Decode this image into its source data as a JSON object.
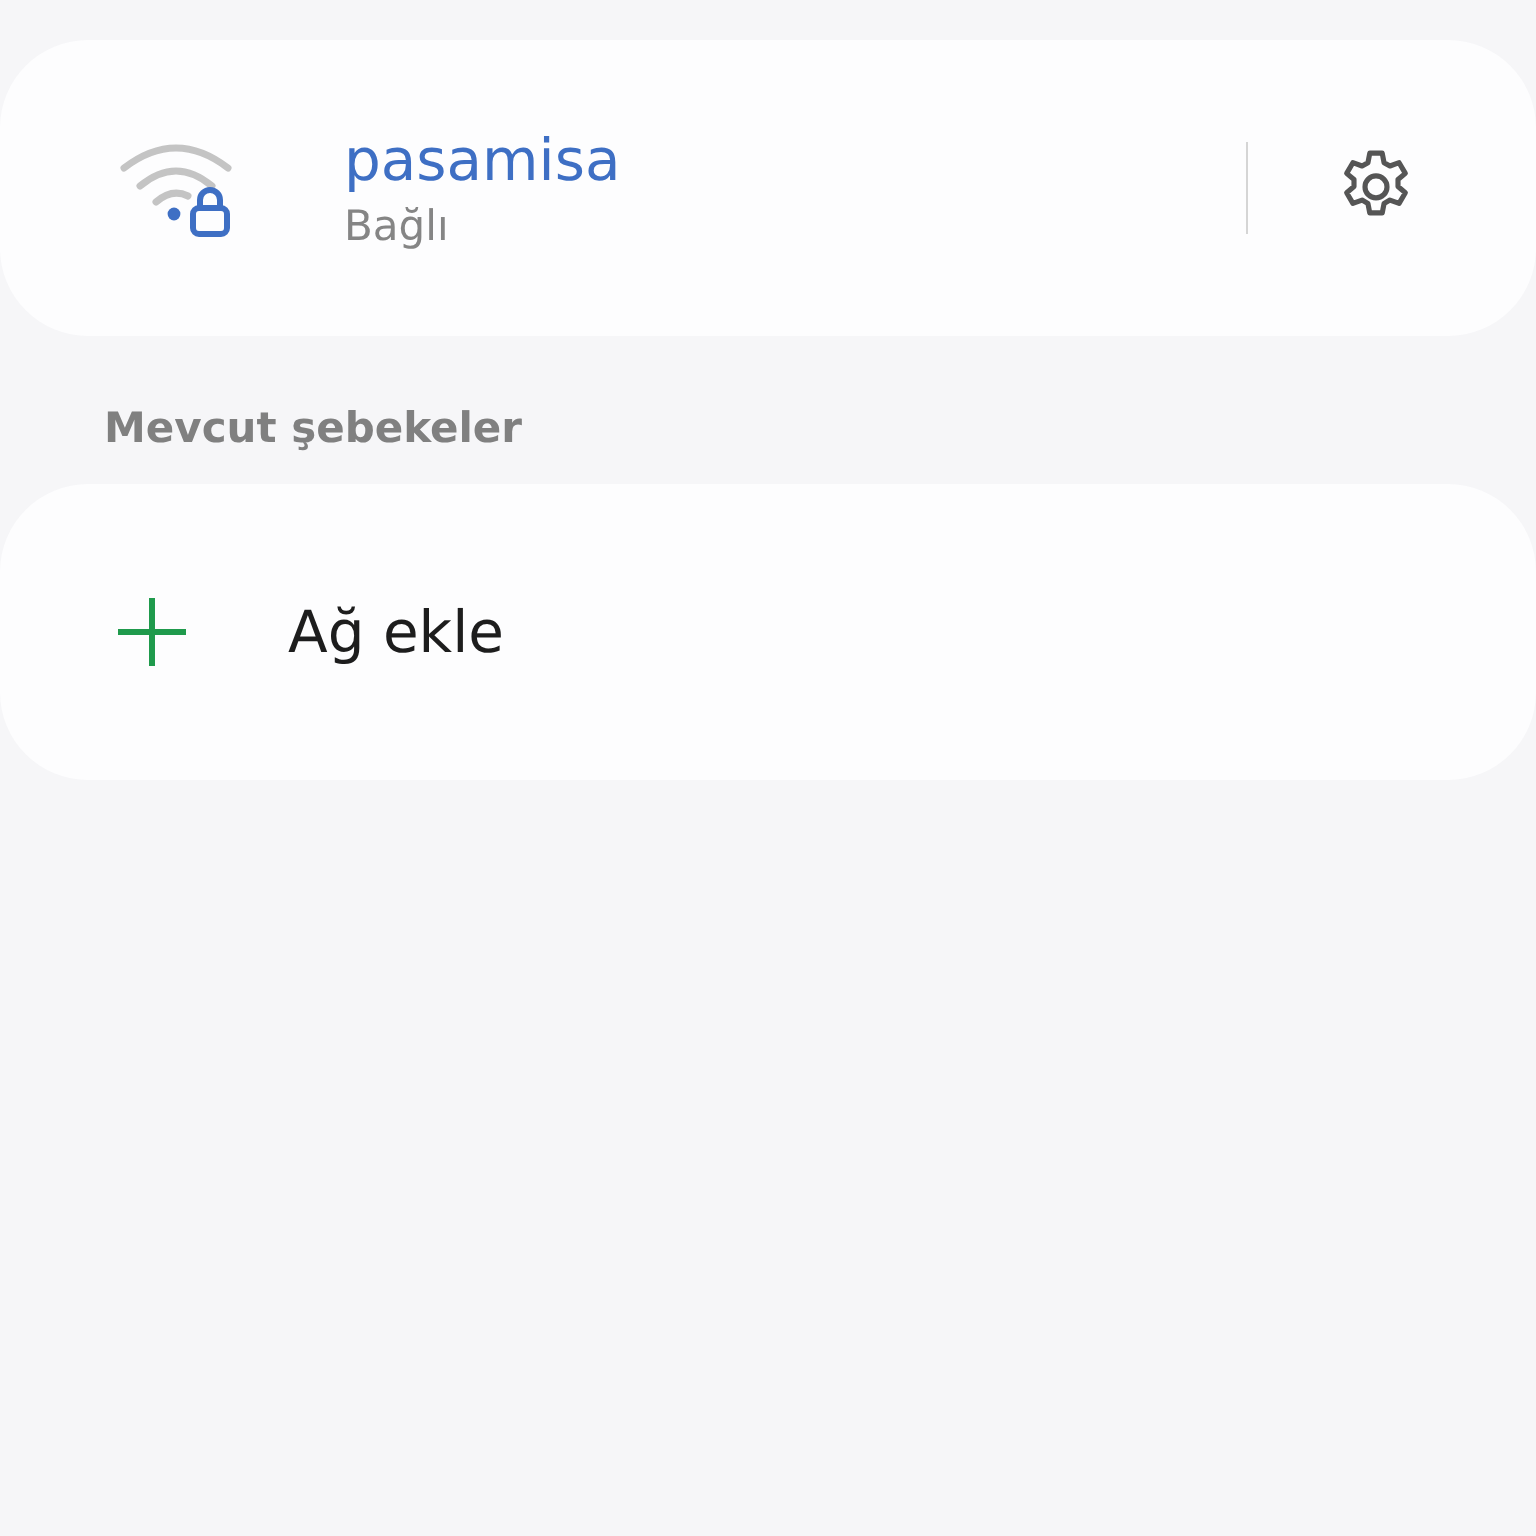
{
  "current_network": {
    "name": "pasamisa",
    "status": "Bağlı",
    "secured": true
  },
  "available_section": {
    "title": "Mevcut şebekeler"
  },
  "add_network": {
    "label": "Ağ ekle"
  }
}
